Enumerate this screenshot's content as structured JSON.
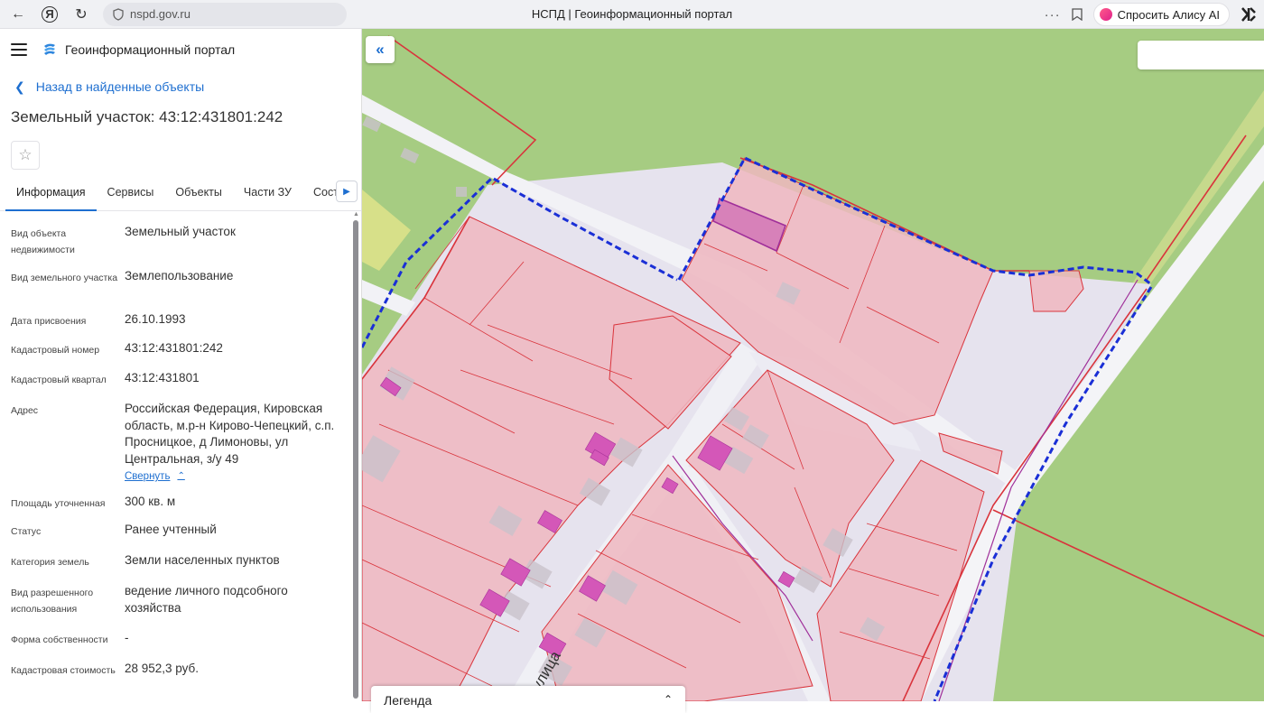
{
  "browser": {
    "url": "nspd.gov.ru",
    "tab_title": "НСПД | Геоинформационный портал",
    "alice_label": "Спросить Алису AI",
    "more": "···"
  },
  "panel": {
    "portal_name": "Геоинформационный портал",
    "back_label": "Назад в найденные объекты",
    "title": "Земельный участок: 43:12:431801:242",
    "tabs": [
      "Информация",
      "Сервисы",
      "Объекты",
      "Части ЗУ",
      "Состав"
    ],
    "active_tab": "Информация",
    "collapse_label": "Свернуть",
    "rows": [
      {
        "label": "Вид объекта недвижимости",
        "value": "Земельный участок"
      },
      {
        "label": "Вид земельного участка",
        "value": "Землепользование"
      },
      {
        "label": "Дата присвоения",
        "value": "26.10.1993"
      },
      {
        "label": "Кадастровый номер",
        "value": "43:12:431801:242"
      },
      {
        "label": "Кадастровый квартал",
        "value": "43:12:431801"
      },
      {
        "label": "Адрес",
        "value": "Российская Федерация, Кировская область, м.р-н Кирово-Чепецкий, с.п. Просницкое, д Лимоновы, ул Центральная, з/у 49"
      },
      {
        "label": "Площадь уточненная",
        "value": "300 кв. м"
      },
      {
        "label": "Статус",
        "value": "Ранее учтенный"
      },
      {
        "label": "Категория земель",
        "value": "Земли населенных пунктов"
      },
      {
        "label": "Вид разрешенного использования",
        "value": "ведение личного подсобного хозяйства"
      },
      {
        "label": "Форма собственности",
        "value": "-"
      },
      {
        "label": "Кадастровая стоимость",
        "value": "28 952,3 руб."
      }
    ]
  },
  "map": {
    "street_label": "улица",
    "legend_label": "Легенда",
    "colors": {
      "grass": "#a6cc82",
      "road": "#ecedf4",
      "parcel_fill": "#efb7c0",
      "parcel_stroke": "#d9343c",
      "building": "#d457b8",
      "boundary_dashed": "#1a2fd6"
    }
  }
}
